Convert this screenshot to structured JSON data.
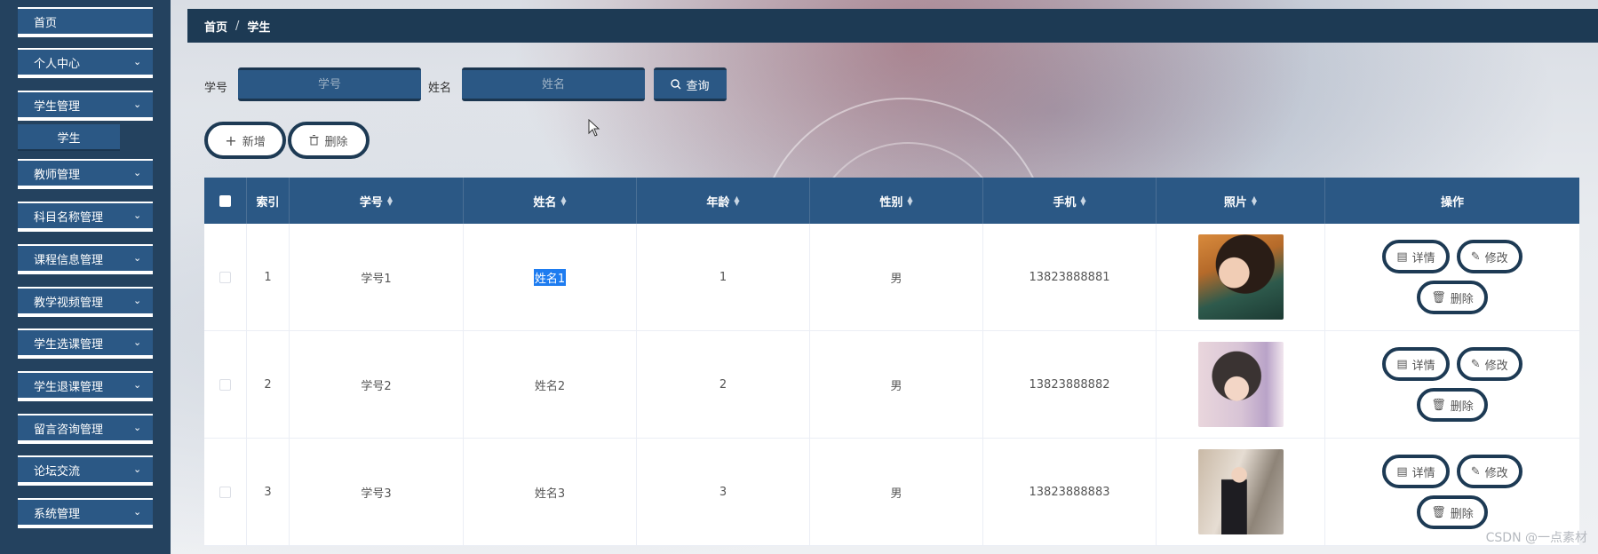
{
  "sidebar": {
    "items": [
      {
        "label": "首页",
        "has_chevron": false
      },
      {
        "label": "个人中心",
        "has_chevron": true
      },
      {
        "label": "学生管理",
        "has_chevron": true
      },
      {
        "label": "教师管理",
        "has_chevron": true
      },
      {
        "label": "科目名称管理",
        "has_chevron": true
      },
      {
        "label": "课程信息管理",
        "has_chevron": true
      },
      {
        "label": "教学视频管理",
        "has_chevron": true
      },
      {
        "label": "学生选课管理",
        "has_chevron": true
      },
      {
        "label": "学生退课管理",
        "has_chevron": true
      },
      {
        "label": "留言咨询管理",
        "has_chevron": true
      },
      {
        "label": "论坛交流",
        "has_chevron": true
      },
      {
        "label": "系统管理",
        "has_chevron": true
      }
    ],
    "sub_item": "学生"
  },
  "breadcrumb": {
    "home": "首页",
    "separator": "/",
    "current": "学生"
  },
  "search": {
    "id_label": "学号",
    "id_placeholder": "学号",
    "name_label": "姓名",
    "name_placeholder": "姓名",
    "button_label": "查询"
  },
  "actions": {
    "add_label": "新增",
    "delete_label": "删除"
  },
  "table": {
    "columns": [
      "索引",
      "学号",
      "姓名",
      "年龄",
      "性别",
      "手机",
      "照片",
      "操作"
    ],
    "rows": [
      {
        "index": "1",
        "student_id": "学号1",
        "name": "姓名1",
        "age": "1",
        "gender": "男",
        "phone": "13823888881"
      },
      {
        "index": "2",
        "student_id": "学号2",
        "name": "姓名2",
        "age": "2",
        "gender": "男",
        "phone": "13823888882"
      },
      {
        "index": "3",
        "student_id": "学号3",
        "name": "姓名3",
        "age": "3",
        "gender": "男",
        "phone": "13823888883"
      }
    ],
    "row_actions": {
      "detail": "详情",
      "edit": "修改",
      "delete": "删除"
    }
  },
  "watermark": "CSDN @一点素材",
  "colors": {
    "sidebar": "#24425f",
    "accent": "#2b5885",
    "header_bar": "#1d3a54",
    "selection": "#1e7cf0"
  }
}
